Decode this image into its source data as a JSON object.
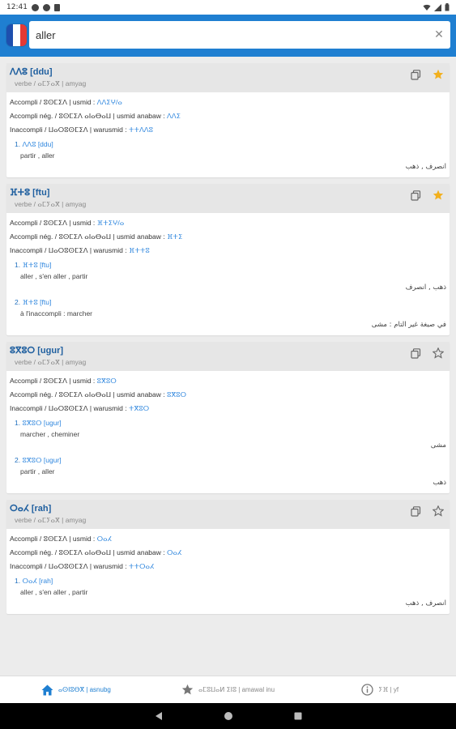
{
  "status_bar": {
    "time": "12:41"
  },
  "search": {
    "value": "aller",
    "clear_symbol": "✕"
  },
  "flag_colors": [
    "#1e4fae",
    "#ffffff",
    "#e53935"
  ],
  "icons": {
    "copy": "copy-icon",
    "star_filled": "star-filled-icon",
    "star_outline": "star-outline-icon",
    "home": "home-icon",
    "favorites": "star-icon",
    "info": "info-icon"
  },
  "colors": {
    "accent": "#1f7fd1",
    "star_gold": "#f2b01e",
    "tifinagh_blue": "#2e86de"
  },
  "entries": [
    {
      "title": "ⴷⴷⵓ [ddu]",
      "pos": "verbe / ⴰⵎⵢⴰⴳ | amyag",
      "forms": [
        {
          "label": "Accompli / ⵓⵙⵎⵉⴷ | usmid : ",
          "value": "ⴷⴷⵉⵖ/ⴰ"
        },
        {
          "label": "Accompli nég. / ⵓⵙⵎⵉⴷ ⴰⵏⴰⴱⴰⵡ | usmid anabaw : ",
          "value": "ⴷⴷⵉ"
        },
        {
          "label": "Inaccompli / ⵡⴰⵔⵓⵙⵎⵉⴷ | warusmid : ",
          "value": "ⵜⵜⴷⴷⵓ"
        }
      ],
      "senses": [
        {
          "num": "1. ",
          "ref": "ⴷⴷⵓ [ddu]",
          "fr": "partir , aller",
          "ar": "انصرف , ذهب"
        }
      ],
      "starred": true
    },
    {
      "title": "ⴼⵜⵓ [ftu]",
      "pos": "verbe / ⴰⵎⵢⴰⴳ | amyag",
      "forms": [
        {
          "label": "Accompli / ⵓⵙⵎⵉⴷ | usmid : ",
          "value": "ⴼⵜⵉⵖ/ⴰ"
        },
        {
          "label": "Accompli nég. / ⵓⵙⵎⵉⴷ ⴰⵏⴰⴱⴰⵡ | usmid anabaw : ",
          "value": "ⴼⵜⵉ"
        },
        {
          "label": "Inaccompli / ⵡⴰⵔⵓⵙⵎⵉⴷ | warusmid : ",
          "value": "ⴼⵜⵜⵓ"
        }
      ],
      "senses": [
        {
          "num": "1. ",
          "ref": "ⴼⵜⵓ [ftu]",
          "fr": "aller , s'en aller , partir",
          "ar": "ذهب , انصرف"
        },
        {
          "num": "2. ",
          "ref": "ⴼⵜⵓ [ftu]",
          "fr": "à l'inaccompli : marcher",
          "ar": "في صيغة غير التام : مشى"
        }
      ],
      "starred": true
    },
    {
      "title": "ⵓⴳⵓⵔ [ugur]",
      "pos": "verbe / ⴰⵎⵢⴰⴳ | amyag",
      "forms": [
        {
          "label": "Accompli / ⵓⵙⵎⵉⴷ | usmid : ",
          "value": "ⵓⴳⵓⵔ"
        },
        {
          "label": "Accompli nég. / ⵓⵙⵎⵉⴷ ⴰⵏⴰⴱⴰⵡ | usmid anabaw : ",
          "value": "ⵓⴳⵓⵔ"
        },
        {
          "label": "Inaccompli / ⵡⴰⵔⵓⵙⵎⵉⴷ | warusmid : ",
          "value": "ⵜⴳⵓⵔ"
        }
      ],
      "senses": [
        {
          "num": "1. ",
          "ref": "ⵓⴳⵓⵔ [ugur]",
          "fr": "marcher , cheminer",
          "ar": "مشى"
        },
        {
          "num": "2. ",
          "ref": "ⵓⴳⵓⵔ [ugur]",
          "fr": "partir , aller",
          "ar": "ذهب"
        }
      ],
      "starred": false
    },
    {
      "title": "ⵔⴰⵃ [rah]",
      "pos": "verbe / ⴰⵎⵢⴰⴳ | amyag",
      "forms": [
        {
          "label": "Accompli / ⵓⵙⵎⵉⴷ | usmid : ",
          "value": "ⵔⴰⵃ"
        },
        {
          "label": "Accompli nég. / ⵓⵙⵎⵉⴷ ⴰⵏⴰⴱⴰⵡ | usmid anabaw : ",
          "value": "ⵔⴰⵃ"
        },
        {
          "label": "Inaccompli / ⵡⴰⵔⵓⵙⵎⵉⴷ | warusmid : ",
          "value": "ⵜⵜⵔⴰⵃ"
        }
      ],
      "senses": [
        {
          "num": "1. ",
          "ref": "ⵔⴰⵃ [rah]",
          "fr": "aller , s'en aller , partir",
          "ar": "انصرف , ذهب"
        }
      ],
      "starred": false
    }
  ],
  "bottom_nav": {
    "items": [
      {
        "label": "ⴰⵙⵏⵓⴱⴳ | asnubg",
        "icon": "home-icon",
        "active": true
      },
      {
        "label": "ⴰⵎⵓⵡⴰⵍ ⵉⵏⵓ | amawal inu",
        "icon": "star-icon",
        "active": false
      },
      {
        "label": "ⵢⴼ | yf",
        "icon": "info-icon",
        "active": false
      }
    ]
  }
}
